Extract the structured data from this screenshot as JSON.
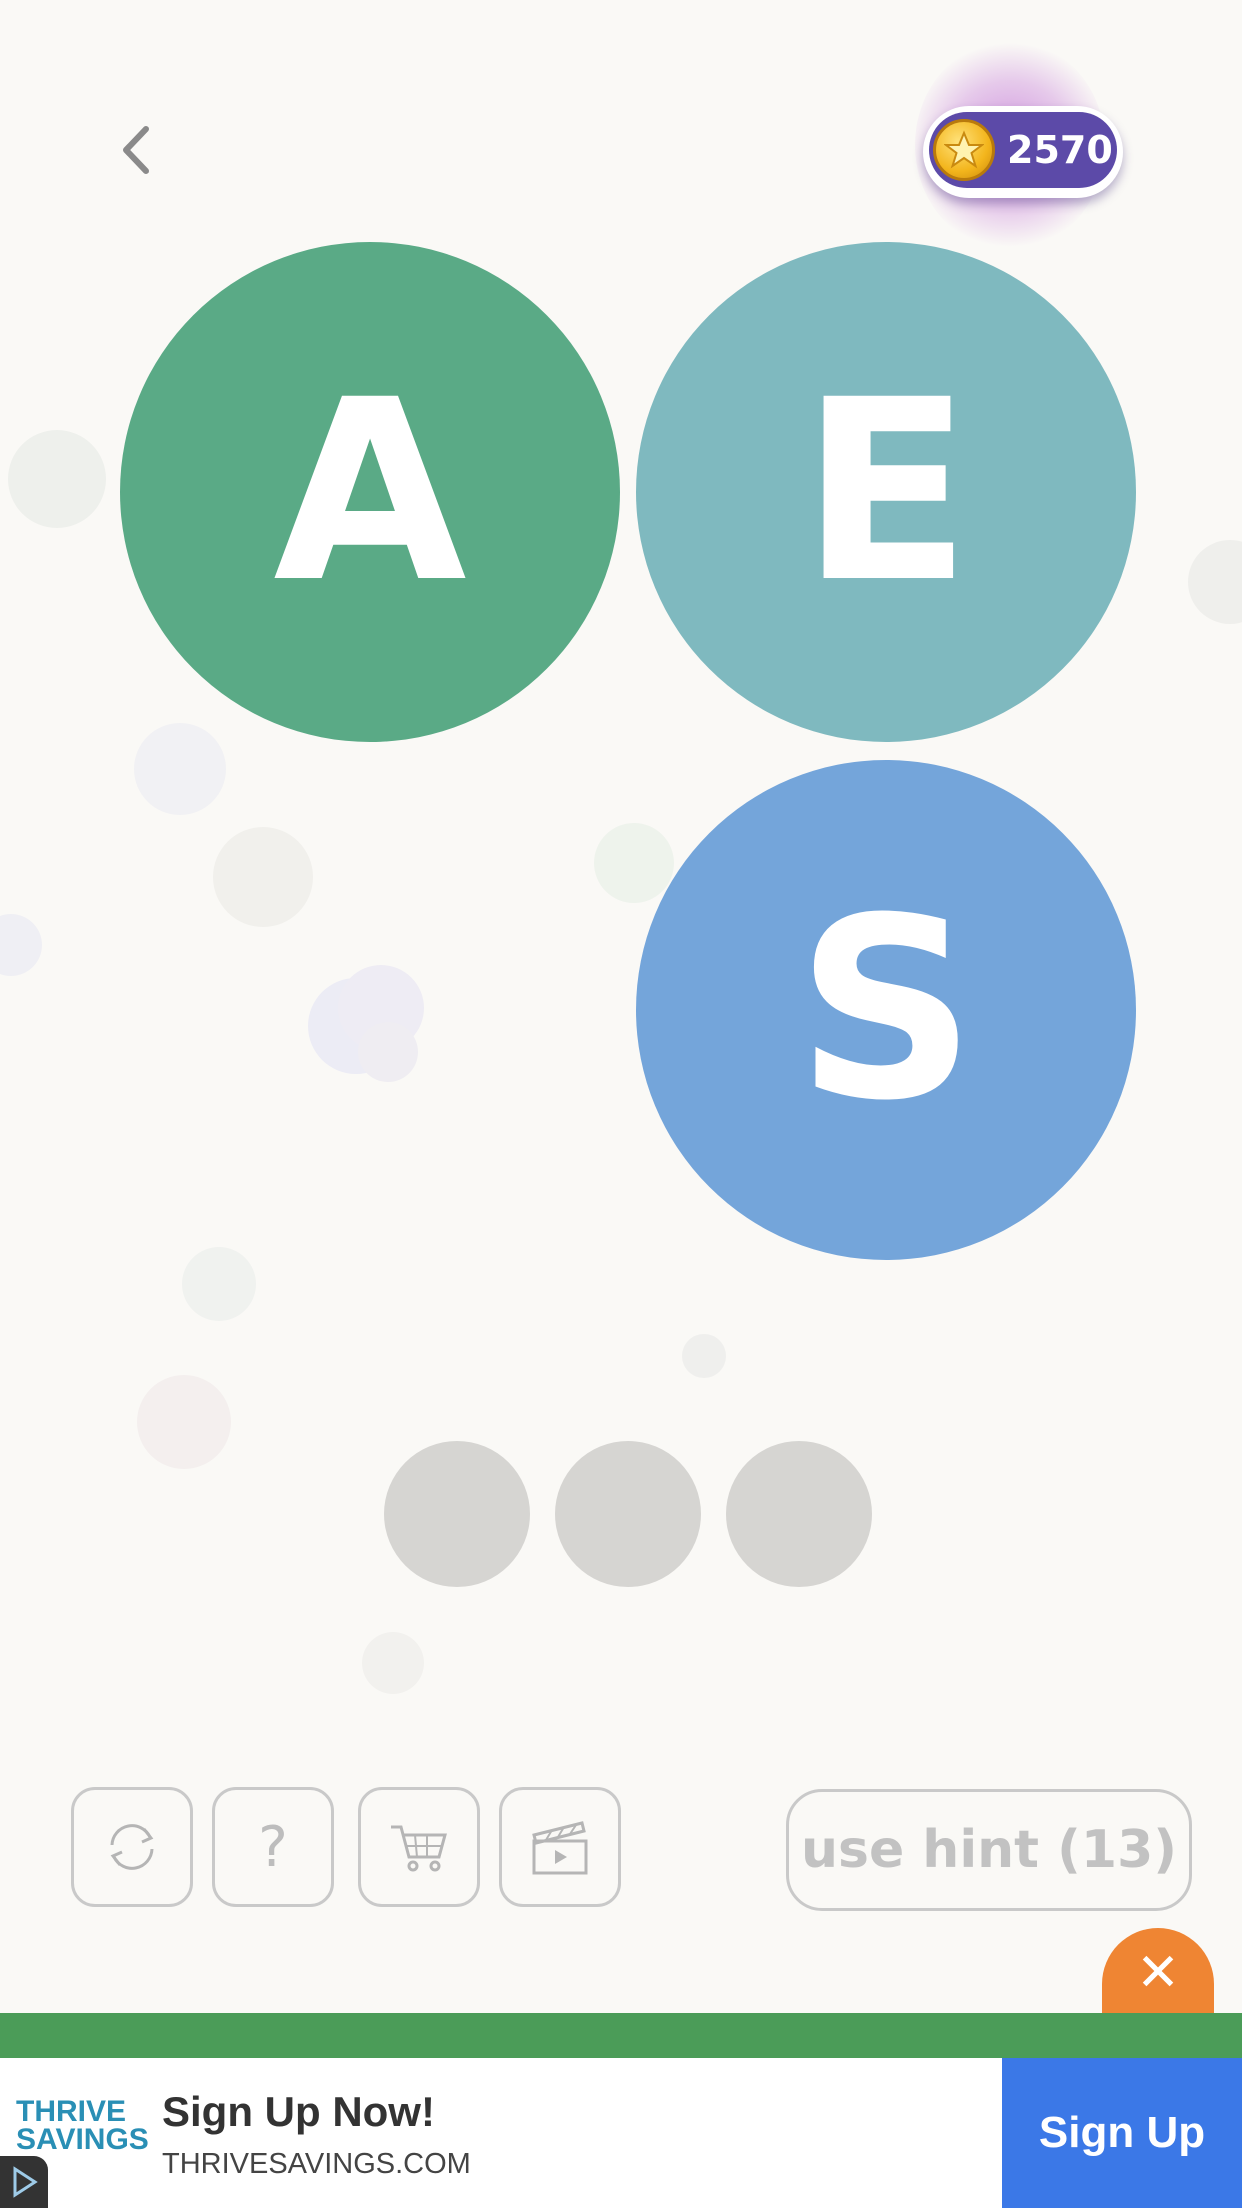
{
  "header": {
    "back_icon": "chevron-left-icon",
    "coins": {
      "icon": "star-coin-icon",
      "count": "2570"
    }
  },
  "letters": [
    {
      "letter": "A",
      "color": "#5aaa86"
    },
    {
      "letter": "E",
      "color": "#7fb9bf"
    },
    {
      "letter": "S",
      "color": "#74a5da"
    }
  ],
  "answer_slots": 3,
  "toolbar": {
    "shuffle_icon": "shuffle-icon",
    "help_label": "?",
    "shop_icon": "cart-icon",
    "video_icon": "clapperboard-icon",
    "hint_label": "use hint (13)"
  },
  "ad": {
    "close_label": "✕",
    "logo_line1": "THRIVE",
    "logo_line2": "SAVINGS",
    "title": "Sign Up Now!",
    "subtitle": "THRIVESAVINGS.COM",
    "cta_label": "Sign Up",
    "colors": {
      "bar": "#4b9c58",
      "cta": "#3b78e7",
      "close": "#ef8533"
    }
  }
}
